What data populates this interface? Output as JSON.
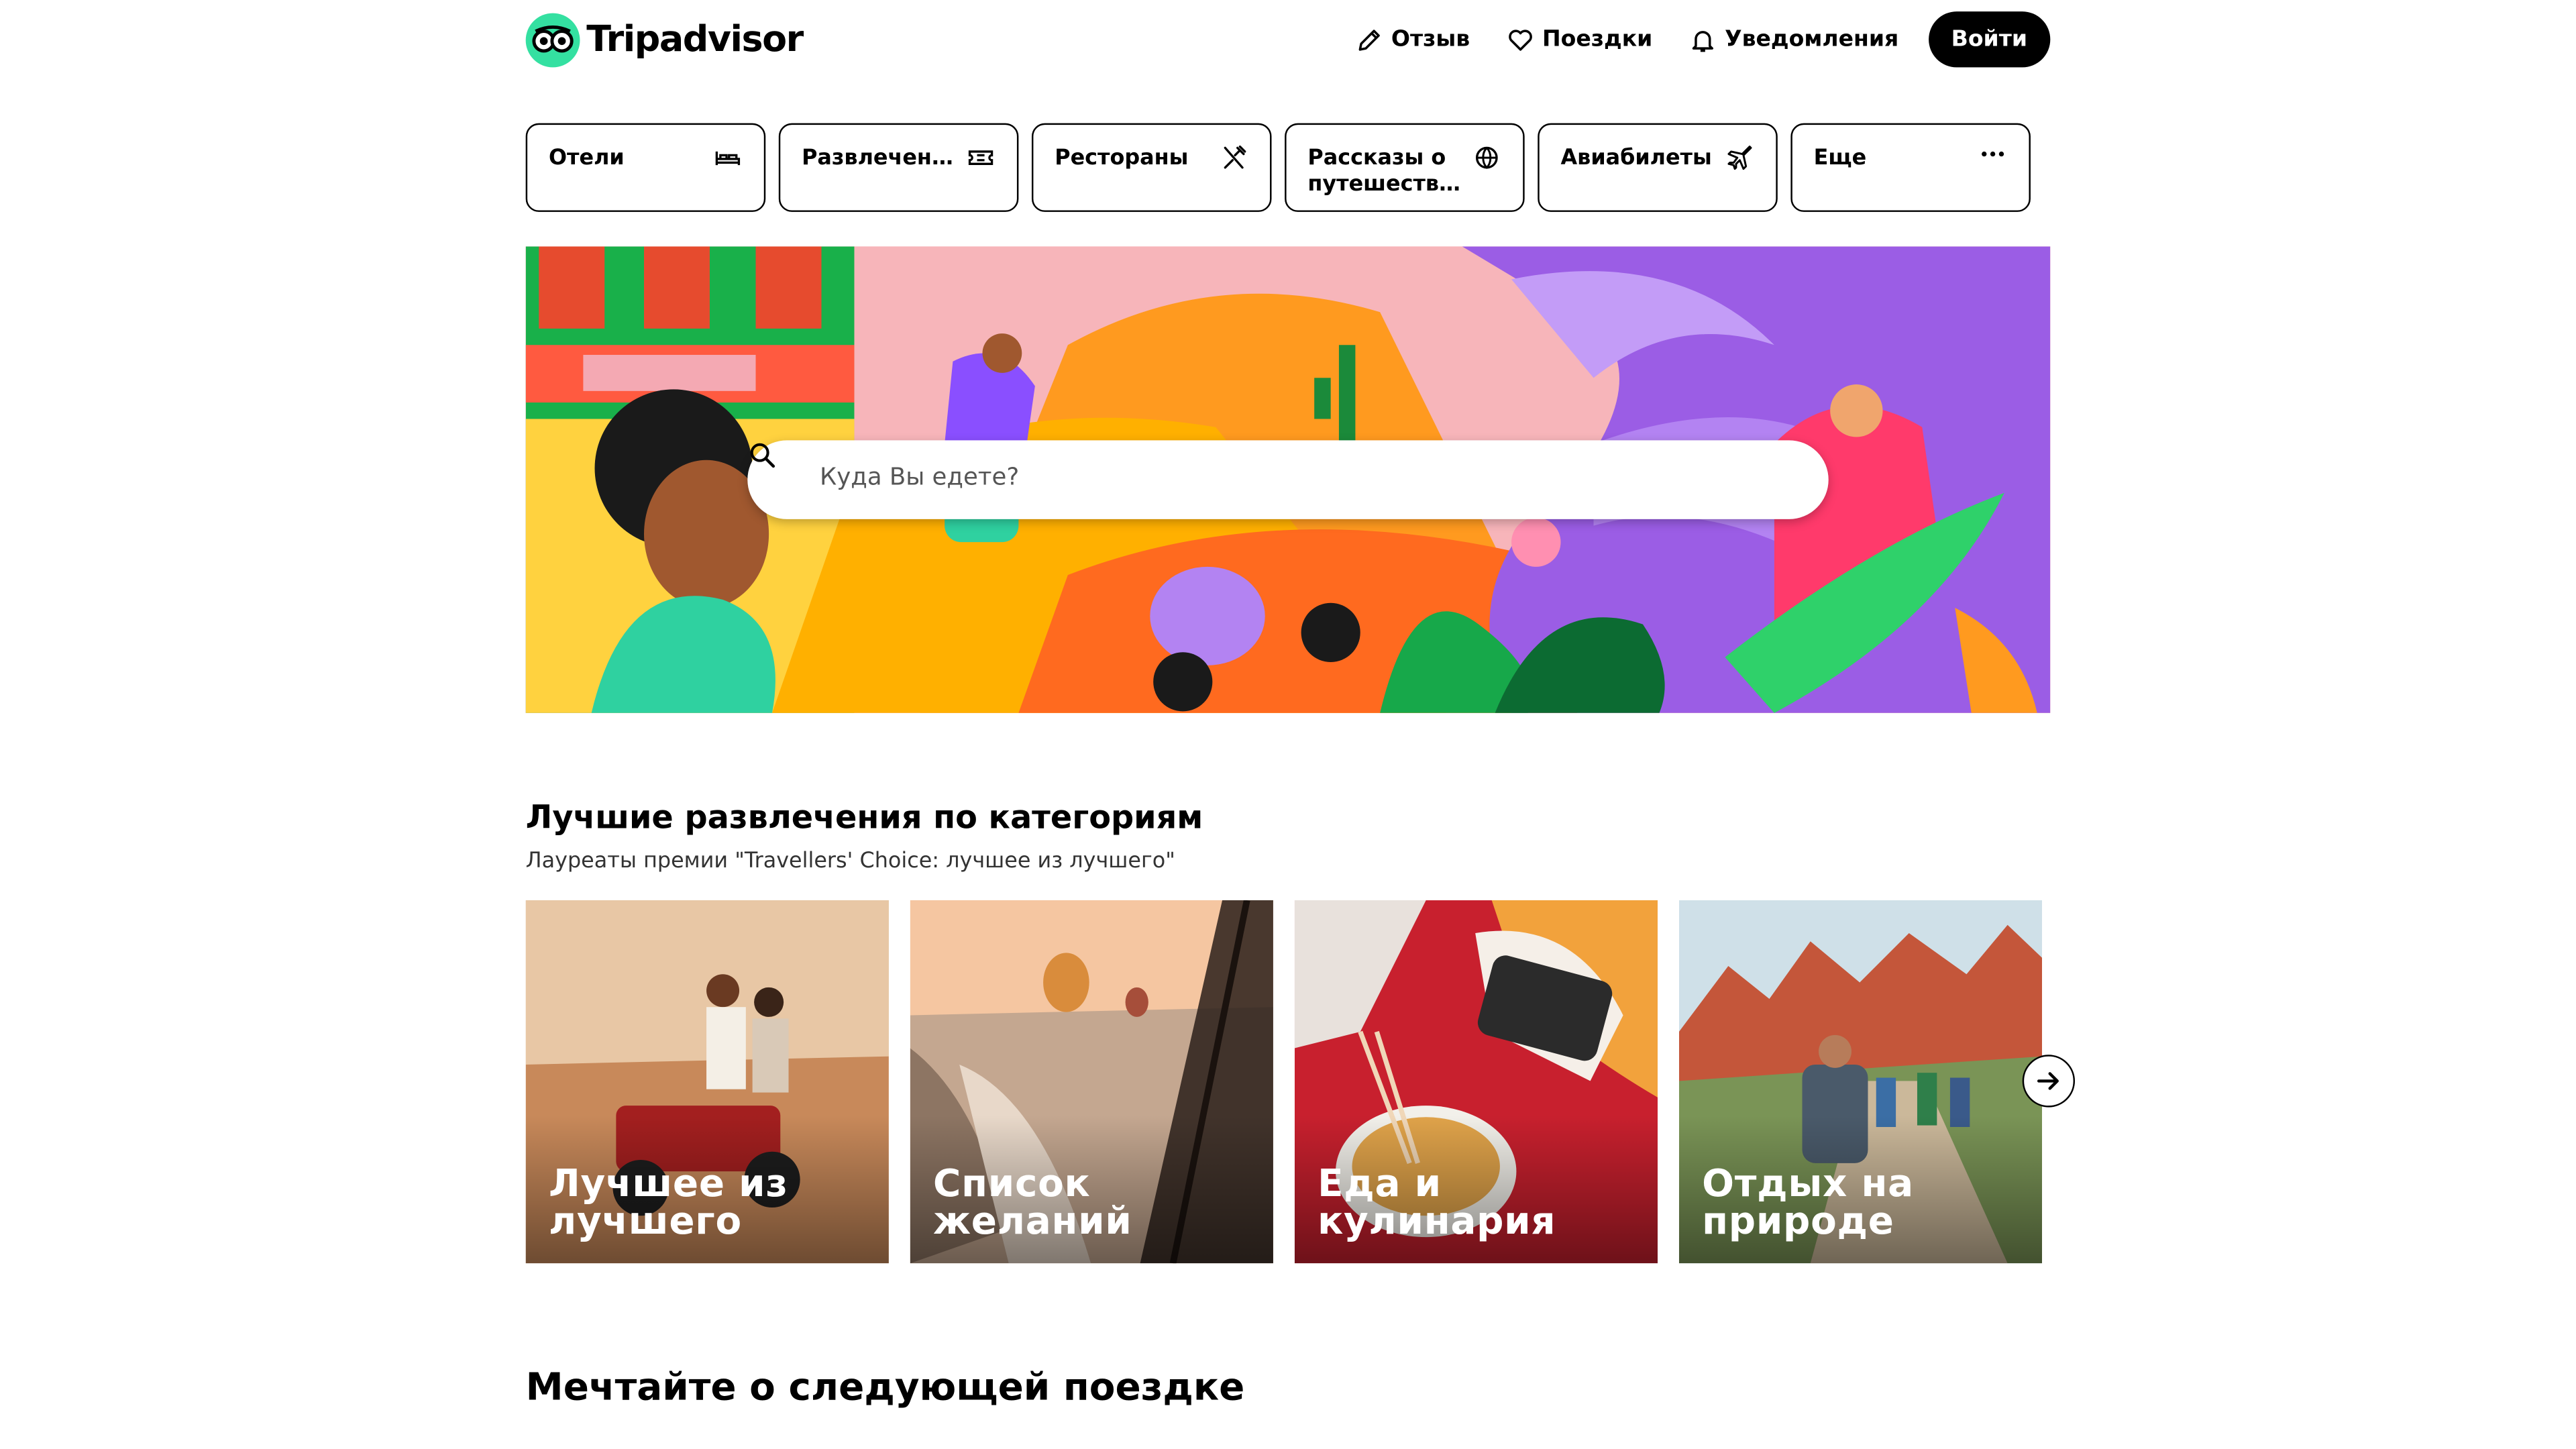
{
  "header": {
    "logo_text": "Tripadvisor",
    "nav": [
      {
        "label": "Отзыв",
        "icon": "pencil-icon"
      },
      {
        "label": "Поездки",
        "icon": "heart-icon"
      },
      {
        "label": "Уведомления",
        "icon": "bell-icon"
      }
    ],
    "login_label": "Войти"
  },
  "categories": [
    {
      "label": "Отели",
      "icon": "bed-icon"
    },
    {
      "label": "Развлечения",
      "icon": "ticket-icon"
    },
    {
      "label": "Рестораны",
      "icon": "fork-knife-icon"
    },
    {
      "label": "Рассказы о путешествиях",
      "icon": "globe-icon"
    },
    {
      "label": "Авиабилеты",
      "icon": "plane-icon"
    },
    {
      "label": "Еще",
      "icon": "more-dots-icon"
    }
  ],
  "hero": {
    "search_placeholder": "Куда Вы едете?"
  },
  "best": {
    "title": "Лучшие развлечения по категориям",
    "subtitle": "Лауреаты премии \"Travellers' Choice: лучшее из лучшего\"",
    "cards": [
      {
        "label": "Лучшее из лучшего"
      },
      {
        "label": "Список желаний"
      },
      {
        "label": "Еда и кулинария"
      },
      {
        "label": "Отдых на природе"
      }
    ]
  },
  "dream": {
    "title": "Мечтайте о следующей поездке"
  },
  "colors": {
    "brand_green": "#34e0a1",
    "button_black": "#000000"
  }
}
